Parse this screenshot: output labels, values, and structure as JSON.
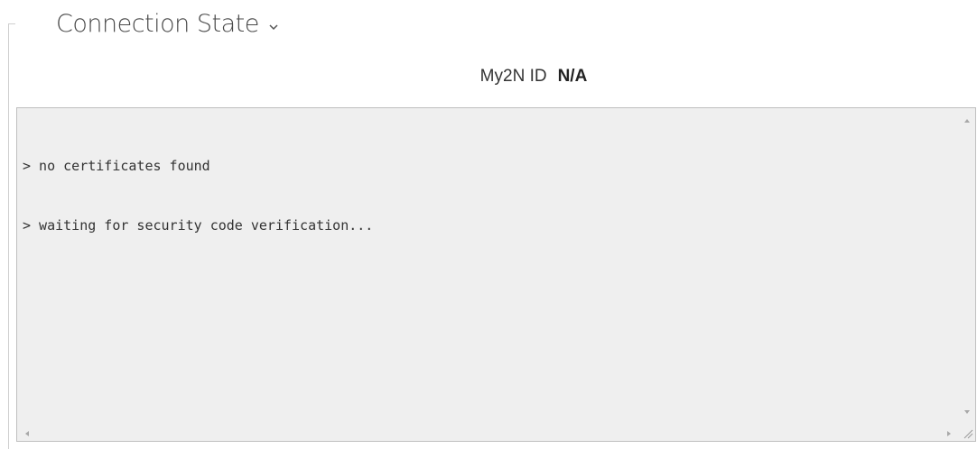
{
  "section": {
    "title": "Connection State",
    "toggle_icon": "chevron-down-icon"
  },
  "my2n": {
    "label": "My2N ID",
    "value": "N/A"
  },
  "console": {
    "lines": [
      "> no certificates found",
      "> waiting for security code verification..."
    ]
  },
  "icons": {
    "scroll_up": "caret-up-icon",
    "scroll_down": "caret-down-icon",
    "scroll_left": "caret-left-icon",
    "scroll_right": "caret-right-icon",
    "resize": "resize-grip-icon"
  }
}
